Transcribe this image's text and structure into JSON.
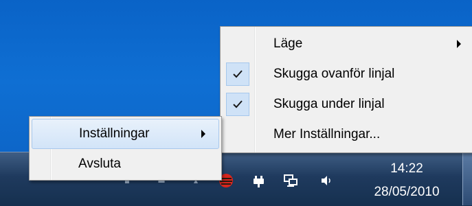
{
  "tray_menu": {
    "items": [
      {
        "label": "Inställningar",
        "has_submenu": true,
        "highlighted": true
      },
      {
        "label": "Avsluta",
        "has_submenu": false,
        "highlighted": false
      }
    ]
  },
  "settings_submenu": {
    "items": [
      {
        "label": "Läge",
        "has_submenu": true,
        "checked": false
      },
      {
        "label": "Skugga ovanför linjal",
        "has_submenu": false,
        "checked": true
      },
      {
        "label": "Skugga under linjal",
        "has_submenu": false,
        "checked": true
      },
      {
        "label": "Mer Inställningar...",
        "has_submenu": false,
        "checked": false
      }
    ]
  },
  "taskbar": {
    "clock_time": "14:22",
    "clock_date": "28/05/2010",
    "tray_icons": [
      "app-tray-icon",
      "power-plug-icon",
      "network-icon",
      "volume-icon"
    ]
  },
  "colors": {
    "desktop": "#0a63c7",
    "taskbar": "#1f3a5e",
    "menu_bg": "#f0f0f0",
    "highlight": "#d2e4f8",
    "check_bg": "#cfe2f7"
  }
}
